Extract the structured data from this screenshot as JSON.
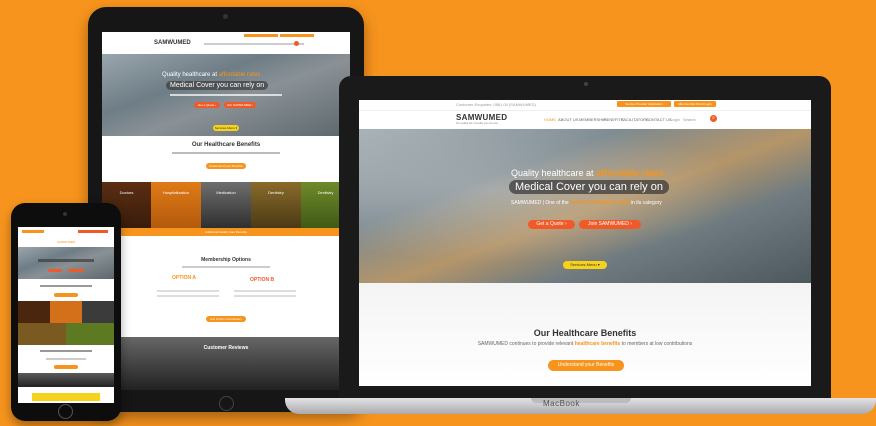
{
  "site": {
    "logo": "SAMWUMED",
    "logo_tag": "for medical aid / benefits you can trust",
    "topbar_left": "Customer Enquiries: 0861 00 (SAMWUMED)",
    "topbar_btn1": "Service Provider Application",
    "topbar_btn2": "Membership Portal Login",
    "nav": [
      "HOME",
      "ABOUT US",
      "MEMBERSHIP",
      "BENEFITS",
      "FACILITATORS",
      "CONTACT US"
    ],
    "nav_login": "Login",
    "nav_search": "Search"
  },
  "hero": {
    "line1_prefix": "Quality healthcare at ",
    "line1_highlight": "affordable rates",
    "line2": "Medical Cover you can rely on",
    "sub_prefix": "SAMWUMED | One of the ",
    "sub_highlight": "lowest contribution rates",
    "sub_suffix": " in its category",
    "btn_quote": "Get a Quote ›",
    "btn_join": "Join SAMWUMED ›",
    "btn_services": "Services Menu ▾"
  },
  "benefits": {
    "title": "Our Healthcare Benefits",
    "sub_prefix": "SAMWUMED continues to provide relevant ",
    "sub_highlight": "healthcare benefits",
    "sub_suffix": " to members at low contributions",
    "button": "Understand your Benefits"
  },
  "tablet": {
    "tiles": [
      "Doctors",
      "Hospitalisation",
      "Medication",
      "Dentistry",
      "Dentistry"
    ],
    "tiles_bar": "Additional Health Care Benefits",
    "membership_title": "Membership Options",
    "option_a": "OPTION A",
    "option_b": "OPTION B",
    "membership_btn": "Get Option Contribution",
    "reviews_title": "Customer Reviews"
  },
  "device_label": "MacBook",
  "colors": {
    "background": "#f7941d",
    "brand_orange": "#f7941d",
    "cta_red": "#f05a28",
    "cta_yellow": "#f7d21c"
  }
}
